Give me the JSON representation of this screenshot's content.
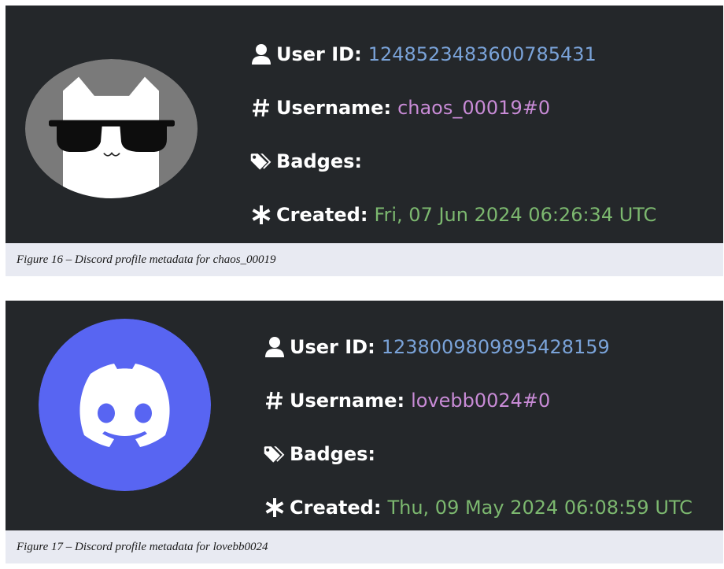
{
  "figures": [
    {
      "avatar": {
        "type": "cat-with-sunglasses",
        "bg_color": "#7a7a7a"
      },
      "fields": {
        "user_id_label": "User ID:",
        "user_id_value": "1248523483600785431",
        "username_label": "Username:",
        "username_value": "chaos_00019#0",
        "badges_label": "Badges:",
        "created_label": "Created:",
        "created_value": "Fri, 07 Jun 2024 06:26:34 UTC"
      },
      "caption": "Figure 16 – Discord profile metadata for chaos_00019"
    },
    {
      "avatar": {
        "type": "discord-logo",
        "bg_color": "#5865f2"
      },
      "fields": {
        "user_id_label": "User ID:",
        "user_id_value": "1238009809895428159",
        "username_label": "Username:",
        "username_value": "lovebb0024#0",
        "badges_label": "Badges:",
        "created_label": "Created:",
        "created_value": "Thu, 09 May 2024 06:08:59 UTC"
      },
      "caption": "Figure 17 – Discord profile metadata for lovebb0024"
    }
  ],
  "colors": {
    "panel_bg": "#24272a",
    "caption_bg": "#e8eaf2",
    "id_value": "#7aa3d9",
    "username_value": "#c88bd6",
    "created_value": "#7cb86f"
  },
  "icons": [
    "user-icon",
    "hash-icon",
    "tags-icon",
    "asterisk-icon"
  ]
}
